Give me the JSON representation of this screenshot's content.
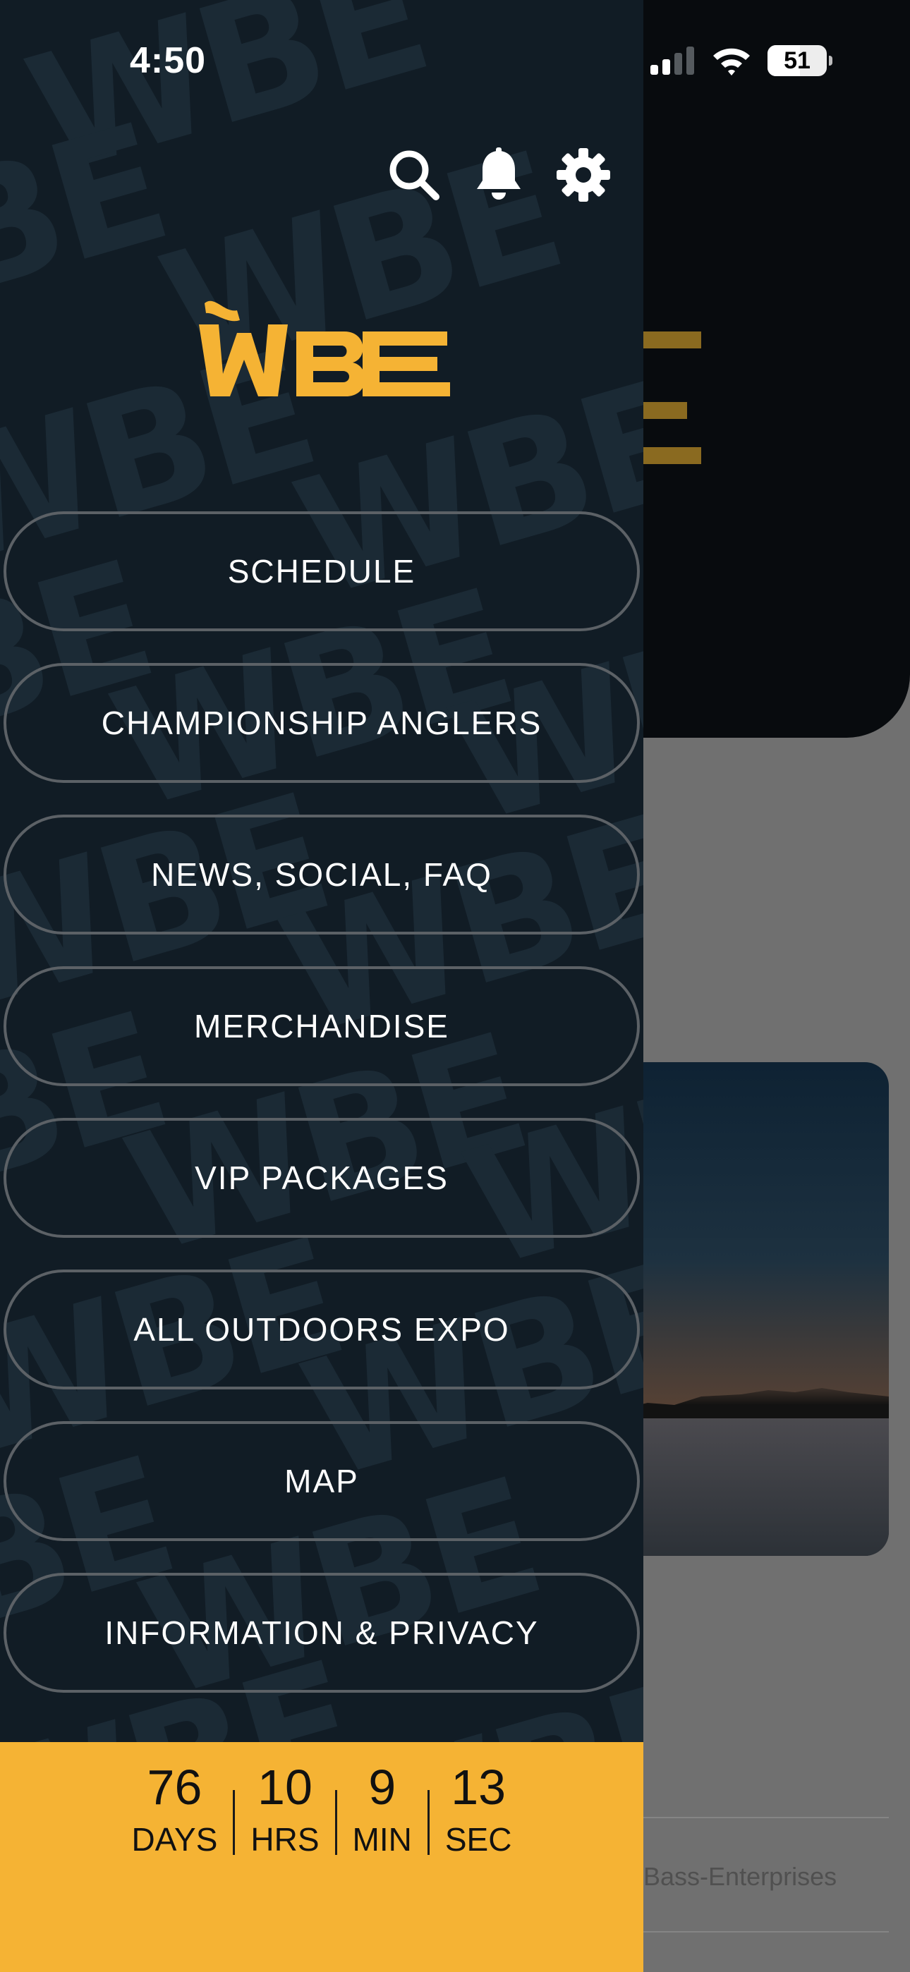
{
  "status_bar": {
    "time": "4:50",
    "battery": "51"
  },
  "top_actions": {
    "search_icon": "search-icon",
    "notifications_icon": "bell-icon",
    "settings_icon": "gear-icon"
  },
  "logo": {
    "text": "WBE",
    "color": "#f5b334"
  },
  "menu": {
    "items": [
      {
        "label": "SCHEDULE"
      },
      {
        "label": "CHAMPIONSHIP ANGLERS"
      },
      {
        "label": "NEWS, SOCIAL, FAQ"
      },
      {
        "label": "MERCHANDISE"
      },
      {
        "label": "VIP PACKAGES"
      },
      {
        "label": "ALL OUTDOORS EXPO"
      },
      {
        "label": "MAP"
      },
      {
        "label": "INFORMATION & PRIVACY"
      }
    ]
  },
  "countdown": {
    "days": "76",
    "days_label": "DAYS",
    "hours": "10",
    "hours_label": "HRS",
    "minutes": "9",
    "minutes_label": "MIN",
    "seconds": "13",
    "seconds_label": "SEC"
  },
  "background": {
    "link_text": "d-Bass-Enterprises"
  },
  "colors": {
    "accent": "#f5b334",
    "drawer_bg": "#111c25",
    "button_border": "#5c6166"
  }
}
